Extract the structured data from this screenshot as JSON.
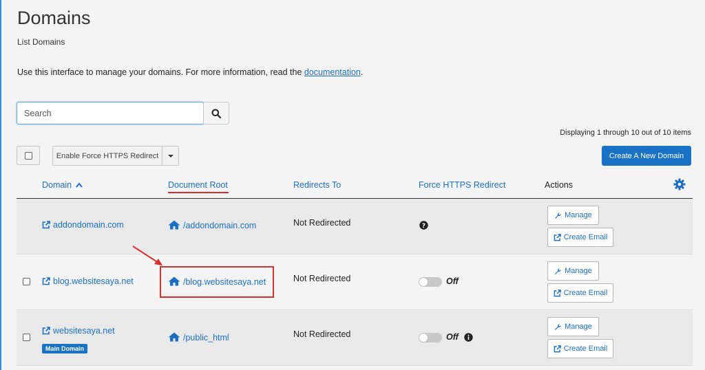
{
  "page": {
    "title": "Domains",
    "subtitle": "List Domains",
    "intro_text": "Use this interface to manage your domains. For more information, read the ",
    "intro_link": "documentation",
    "intro_end": "."
  },
  "search": {
    "placeholder": "Search",
    "value": ""
  },
  "toolbar": {
    "displaying": "Displaying 1 through 10 out of 10 items",
    "force_https_button": "Enable Force HTTPS Redirect",
    "create_button": "Create A New Domain"
  },
  "table": {
    "headers": {
      "domain": "Domain",
      "document_root": "Document Root",
      "redirects_to": "Redirects To",
      "force_https": "Force HTTPS Redirect",
      "actions": "Actions"
    },
    "rows": [
      {
        "domain": "addondomain.com",
        "document_root": "/addondomain.com",
        "redirects_to": "Not Redirected",
        "force_https": "",
        "manage": "Manage",
        "create_email": "Create Email"
      },
      {
        "domain": "blog.websitesaya.net",
        "document_root": "/blog.websitesaya.net",
        "redirects_to": "Not Redirected",
        "force_https": "Off",
        "manage": "Manage",
        "create_email": "Create Email"
      },
      {
        "domain": "websitesaya.net",
        "badge": "Main Domain",
        "document_root": "/public_html",
        "redirects_to": "Not Redirected",
        "force_https": "Off",
        "manage": "Manage",
        "create_email": "Create Email"
      }
    ]
  },
  "colors": {
    "link": "#1b6fc2",
    "primary_button": "#1a72c6",
    "annotation": "#d9302f"
  }
}
